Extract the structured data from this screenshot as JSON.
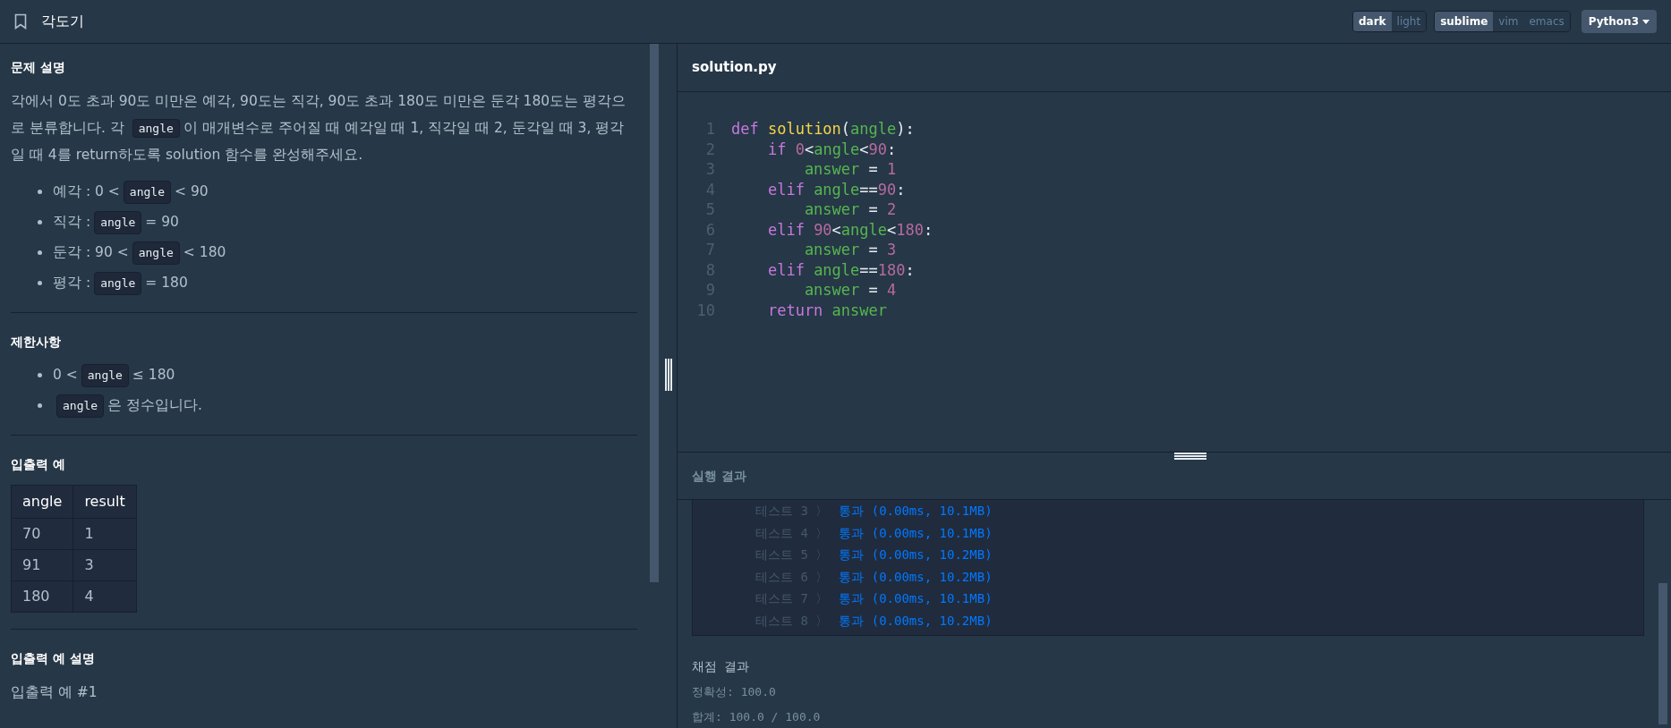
{
  "header": {
    "title": "각도기",
    "themes": [
      {
        "label": "dark",
        "selected": true
      },
      {
        "label": "light",
        "selected": false
      }
    ],
    "keymaps": [
      {
        "label": "sublime",
        "selected": true
      },
      {
        "label": "vim",
        "selected": false
      },
      {
        "label": "emacs",
        "selected": false
      }
    ],
    "language": "Python3"
  },
  "problem": {
    "sections": [
      {
        "heading": "문제 설명",
        "blocks": [
          {
            "kind": "paragraph",
            "parts": [
              {
                "kind": "text",
                "text": "각에서 0도 초과 90도 미만은 예각, 90도는 직각, 90도 초과 180도 미만은 둔각 180도는 평각으로 분류합니다. 각 "
              },
              {
                "kind": "code",
                "text": "angle"
              },
              {
                "kind": "text",
                "text": "이 매개변수로 주어질 때 예각일 때 1, 직각일 때 2, 둔각일 때 3, 평각일 때 4를 return하도록 solution 함수를 완성해주세요."
              }
            ]
          },
          {
            "kind": "list",
            "items": [
              [
                {
                  "kind": "text",
                  "text": "예각 : 0 <"
                },
                {
                  "kind": "code",
                  "text": "angle"
                },
                {
                  "kind": "text",
                  "text": "< 90"
                }
              ],
              [
                {
                  "kind": "text",
                  "text": "직각 :"
                },
                {
                  "kind": "code",
                  "text": "angle"
                },
                {
                  "kind": "text",
                  "text": "= 90"
                }
              ],
              [
                {
                  "kind": "text",
                  "text": "둔각 : 90 <"
                },
                {
                  "kind": "code",
                  "text": "angle"
                },
                {
                  "kind": "text",
                  "text": "< 180"
                }
              ],
              [
                {
                  "kind": "text",
                  "text": "평각 :"
                },
                {
                  "kind": "code",
                  "text": "angle"
                },
                {
                  "kind": "text",
                  "text": "= 180"
                }
              ]
            ]
          }
        ]
      },
      {
        "heading": "제한사항",
        "blocks": [
          {
            "kind": "list",
            "items": [
              [
                {
                  "kind": "text",
                  "text": "0 <"
                },
                {
                  "kind": "code",
                  "text": "angle"
                },
                {
                  "kind": "text",
                  "text": "≤ 180"
                }
              ],
              [
                {
                  "kind": "code",
                  "text": "angle"
                },
                {
                  "kind": "text",
                  "text": "은 정수입니다."
                }
              ]
            ]
          }
        ]
      },
      {
        "heading": "입출력 예",
        "blocks": [
          {
            "kind": "table",
            "columns": [
              "angle",
              "result"
            ],
            "rows": [
              [
                "70",
                "1"
              ],
              [
                "91",
                "3"
              ],
              [
                "180",
                "4"
              ]
            ]
          }
        ]
      },
      {
        "heading": "입출력 예 설명",
        "blocks": [
          {
            "kind": "paragraph",
            "parts": [
              {
                "kind": "text",
                "text": "입출력 예 #1"
              }
            ]
          }
        ]
      }
    ]
  },
  "editor": {
    "filename": "solution.py",
    "lines": [
      {
        "number": "1",
        "tokens": [
          {
            "kind": "keyword",
            "text": "def "
          },
          {
            "kind": "function",
            "text": "solution"
          },
          {
            "kind": "plain",
            "text": "("
          },
          {
            "kind": "name",
            "text": "angle"
          },
          {
            "kind": "plain",
            "text": "):"
          }
        ]
      },
      {
        "number": "2",
        "tokens": [
          {
            "kind": "keyword",
            "text": "    if "
          },
          {
            "kind": "number",
            "text": "0"
          },
          {
            "kind": "plain",
            "text": "<"
          },
          {
            "kind": "name",
            "text": "angle"
          },
          {
            "kind": "plain",
            "text": "<"
          },
          {
            "kind": "number",
            "text": "90"
          },
          {
            "kind": "plain",
            "text": ":"
          }
        ]
      },
      {
        "number": "3",
        "tokens": [
          {
            "kind": "name",
            "text": "        answer"
          },
          {
            "kind": "plain",
            "text": " = "
          },
          {
            "kind": "number",
            "text": "1"
          }
        ]
      },
      {
        "number": "4",
        "tokens": [
          {
            "kind": "keyword",
            "text": "    elif "
          },
          {
            "kind": "name",
            "text": "angle"
          },
          {
            "kind": "plain",
            "text": "=="
          },
          {
            "kind": "number",
            "text": "90"
          },
          {
            "kind": "plain",
            "text": ":"
          }
        ]
      },
      {
        "number": "5",
        "tokens": [
          {
            "kind": "name",
            "text": "        answer"
          },
          {
            "kind": "plain",
            "text": " = "
          },
          {
            "kind": "number",
            "text": "2"
          }
        ]
      },
      {
        "number": "6",
        "tokens": [
          {
            "kind": "keyword",
            "text": "    elif "
          },
          {
            "kind": "number",
            "text": "90"
          },
          {
            "kind": "plain",
            "text": "<"
          },
          {
            "kind": "name",
            "text": "angle"
          },
          {
            "kind": "plain",
            "text": "<"
          },
          {
            "kind": "number",
            "text": "180"
          },
          {
            "kind": "plain",
            "text": ":"
          }
        ]
      },
      {
        "number": "7",
        "tokens": [
          {
            "kind": "name",
            "text": "        answer"
          },
          {
            "kind": "plain",
            "text": " = "
          },
          {
            "kind": "number",
            "text": "3"
          }
        ]
      },
      {
        "number": "8",
        "tokens": [
          {
            "kind": "keyword",
            "text": "    elif "
          },
          {
            "kind": "name",
            "text": "angle"
          },
          {
            "kind": "plain",
            "text": "=="
          },
          {
            "kind": "number",
            "text": "180"
          },
          {
            "kind": "plain",
            "text": ":"
          }
        ]
      },
      {
        "number": "9",
        "tokens": [
          {
            "kind": "name",
            "text": "        answer"
          },
          {
            "kind": "plain",
            "text": " = "
          },
          {
            "kind": "number",
            "text": "4"
          }
        ]
      },
      {
        "number": "10",
        "tokens": [
          {
            "kind": "keyword",
            "text": "    return "
          },
          {
            "kind": "name",
            "text": "answer"
          }
        ]
      }
    ]
  },
  "results": {
    "title": "실행 결과",
    "tests": [
      {
        "label": "테스트 3 〉",
        "result": "통과 (0.00ms, 10.1MB)"
      },
      {
        "label": "테스트 4 〉",
        "result": "통과 (0.00ms, 10.1MB)"
      },
      {
        "label": "테스트 5 〉",
        "result": "통과 (0.00ms, 10.2MB)"
      },
      {
        "label": "테스트 6 〉",
        "result": "통과 (0.00ms, 10.2MB)"
      },
      {
        "label": "테스트 7 〉",
        "result": "통과 (0.00ms, 10.1MB)"
      },
      {
        "label": "테스트 8 〉",
        "result": "통과 (0.00ms, 10.2MB)"
      }
    ],
    "grading_title": "채점 결과",
    "grading": [
      "정확성: 100.0",
      "합계: 100.0 / 100.0"
    ]
  }
}
